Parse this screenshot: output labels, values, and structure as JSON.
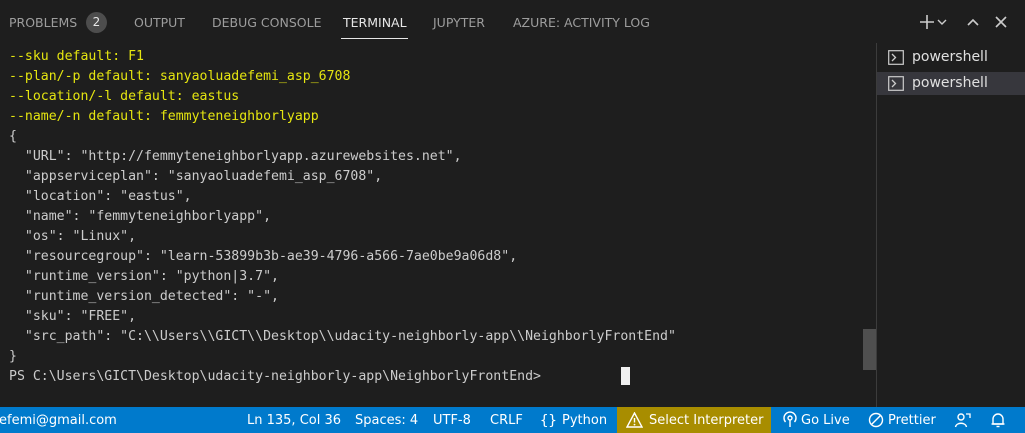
{
  "tabs": {
    "problems": {
      "label": "PROBLEMS",
      "count": "2"
    },
    "output": "OUTPUT",
    "debug_console": "DEBUG CONSOLE",
    "terminal": "TERMINAL",
    "jupyter": "JUPYTER",
    "azure_activity_log": "AZURE: ACTIVITY LOG"
  },
  "controls": [
    "plus-icon",
    "chevron-down-icon",
    "chevron-up-icon",
    "close-icon"
  ],
  "terminal": {
    "lines": [
      "--sku default: F1",
      "--plan/-p default: sanyaoluadefemi_asp_6708",
      "--location/-l default: eastus",
      "--name/-n default: femmyteneighborlyapp",
      "{",
      "  \"URL\": \"http://femmyteneighborlyapp.azurewebsites.net\",",
      "  \"appserviceplan\": \"sanyaoluadefemi_asp_6708\",",
      "  \"location\": \"eastus\",",
      "  \"name\": \"femmyteneighborlyapp\",",
      "  \"os\": \"Linux\",",
      "  \"resourcegroup\": \"learn-53899b3b-ae39-4796-a566-7ae0be9a06d8\",",
      "  \"runtime_version\": \"python|3.7\",",
      "  \"runtime_version_detected\": \"-\",",
      "  \"sku\": \"FREE\",",
      "  \"src_path\": \"C:\\\\Users\\\\GICT\\\\Desktop\\\\udacity-neighborly-app\\\\NeighborlyFrontEnd\"",
      "}",
      "PS C:\\Users\\GICT\\Desktop\\udacity-neighborly-app\\NeighborlyFrontEnd> "
    ]
  },
  "terminal_list": [
    {
      "label": "powershell",
      "selected": false
    },
    {
      "label": "powershell",
      "selected": true
    }
  ],
  "status": {
    "account": "efemi@gmail.com",
    "position": "Ln 135, Col 36",
    "spaces": "Spaces: 4",
    "encoding": "UTF-8",
    "eol": "CRLF",
    "language": "Python",
    "interpreter": "Select Interpreter",
    "golive": "Go Live",
    "prettier": "Prettier"
  },
  "colors": {
    "accent": "#007acc",
    "warning_bg": "#a88d00",
    "yellow_text": "#e5e510"
  }
}
